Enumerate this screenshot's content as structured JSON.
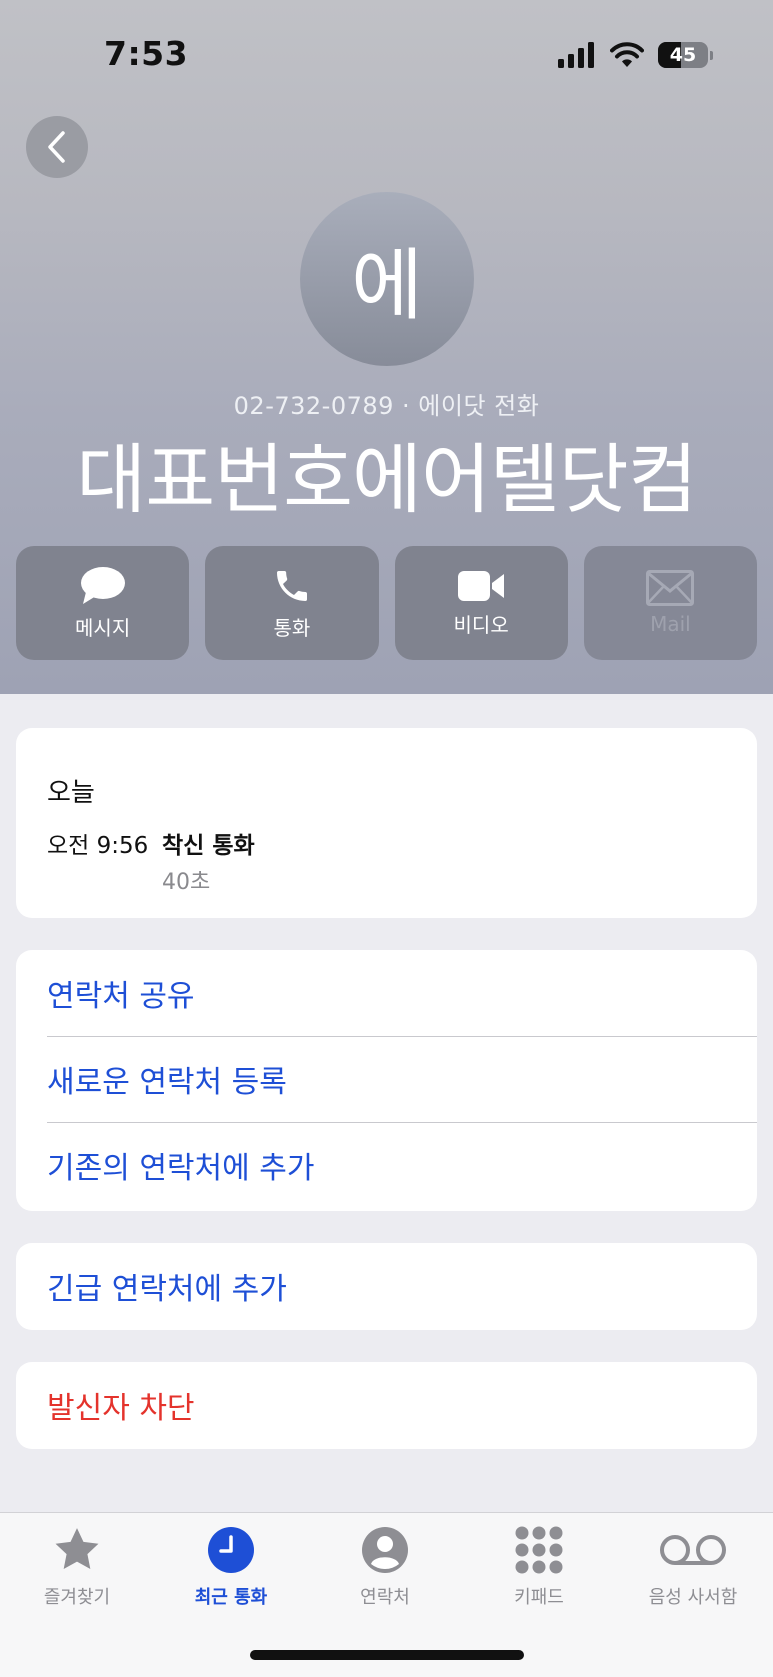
{
  "status_bar": {
    "time": "7:53",
    "battery": "45"
  },
  "contact": {
    "avatar_initial": "에",
    "subtitle": "02-732-0789 · 에이닷 전화",
    "name": "대표번호에어텔닷컴"
  },
  "actions": [
    {
      "label": "메시지",
      "icon": "message-icon"
    },
    {
      "label": "통화",
      "icon": "phone-icon"
    },
    {
      "label": "비디오",
      "icon": "video-icon"
    },
    {
      "label": "Mail",
      "icon": "mail-icon",
      "disabled": true
    }
  ],
  "recent_calls": {
    "day": "오늘",
    "time": "오전 9:56",
    "type": "착신 통화",
    "duration": "40초"
  },
  "options": [
    "연락처 공유",
    "새로운 연락처 등록",
    "기존의 연락처에 추가"
  ],
  "emergency": "긴급 연락처에 추가",
  "block": "발신자 차단",
  "tabs": [
    {
      "label": "즐겨찾기",
      "icon": "star-icon"
    },
    {
      "label": "최근 통화",
      "icon": "clock-icon",
      "active": true
    },
    {
      "label": "연락처",
      "icon": "person-icon"
    },
    {
      "label": "키패드",
      "icon": "keypad-icon"
    },
    {
      "label": "음성 사서함",
      "icon": "voicemail-icon"
    }
  ],
  "colors": {
    "accent": "#1e4fd6",
    "danger": "#e4332c"
  }
}
